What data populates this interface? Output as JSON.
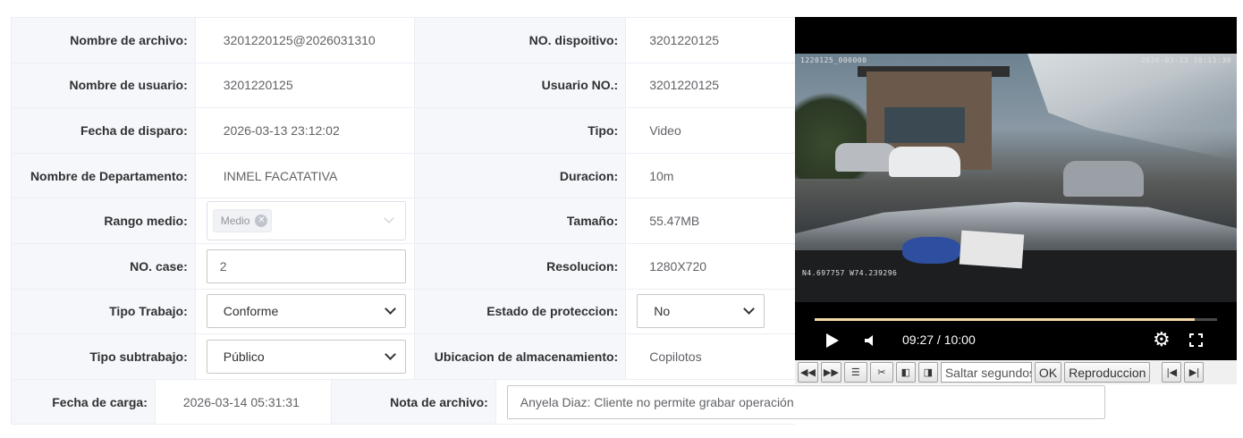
{
  "rows": [
    {
      "l1": "Nombre de archivo:",
      "v1": "3201220125@2026031310",
      "l2": "NO. dispoitivo:",
      "v2": "3201220125"
    },
    {
      "l1": "Nombre de usuario:",
      "v1": "3201220125",
      "l2": "Usuario NO.:",
      "v2": "3201220125"
    },
    {
      "l1": "Fecha de disparo:",
      "v1": "2026-03-13 23:12:02",
      "l2": "Tipo:",
      "v2": "Video"
    },
    {
      "l1": "Nombre de Departamento:",
      "v1": "INMEL FACATATIVA",
      "l2": "Duracion:",
      "v2": "10m"
    },
    {
      "l1": "Rango medio:",
      "v1_tag": "Medio",
      "l2": "Tamaño:",
      "v2": "55.47MB"
    },
    {
      "l1": "NO. case:",
      "v1_input": "2",
      "l2": "Resolucion:",
      "v2": "1280X720"
    },
    {
      "l1": "Tipo Trabajo:",
      "v1_select": "Conforme",
      "l2": "Estado de proteccion:",
      "v2_select": "No"
    },
    {
      "l1": "Tipo subtrabajo:",
      "v1_select": "Público",
      "l2": "Ubicacion de almacenamiento:",
      "v2": "Copilotos"
    },
    {
      "l1": "Fecha de carga:",
      "v1": "2026-03-14 05:31:31",
      "l2": "Nota de archivo:",
      "v2_input": "Anyela Diaz: Cliente no permite grabar operación"
    }
  ],
  "video": {
    "osd_top_left": "1220125_000000",
    "osd_top_right": "2026-03-13 10:11:30",
    "osd_bottom_left": "N4.697757 W74.239296",
    "time": "09:27 / 10:00",
    "progress": 0.945,
    "colors": {
      "progress": "#f2d9a6",
      "background": "#000000"
    }
  },
  "toolbar": {
    "rewind": "◀◀",
    "forward": "▶▶",
    "list": "☰",
    "cut": "✂",
    "prev_frame": "◧",
    "next_frame": "◨",
    "seek_placeholder": "Saltar segundos",
    "ok": "OK",
    "playback": "Reproduccion",
    "skip_prev": "|◀",
    "skip_next": "▶|"
  }
}
